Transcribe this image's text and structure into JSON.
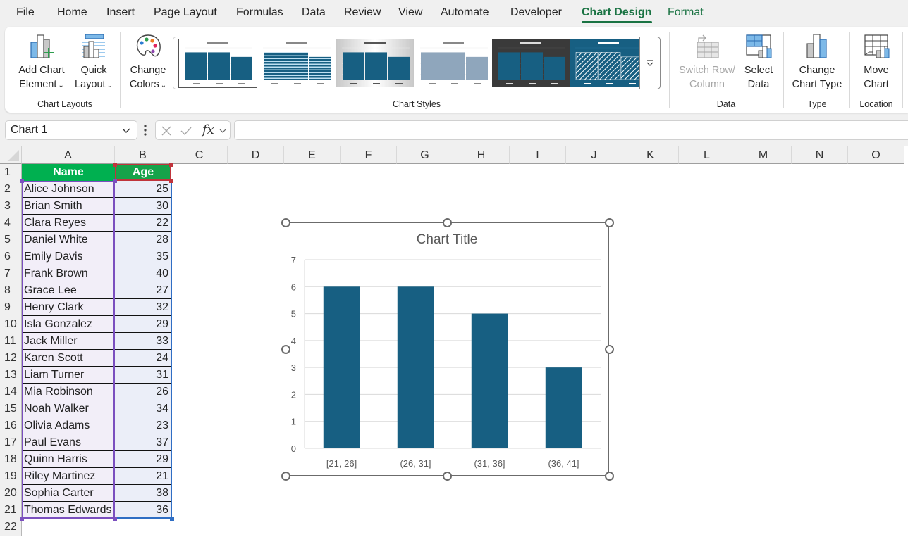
{
  "menu": {
    "tabs": [
      {
        "label": "File",
        "active": false
      },
      {
        "label": "Home",
        "active": false
      },
      {
        "label": "Insert",
        "active": false
      },
      {
        "label": "Page Layout",
        "active": false
      },
      {
        "label": "Formulas",
        "active": false
      },
      {
        "label": "Data",
        "active": false
      },
      {
        "label": "Review",
        "active": false
      },
      {
        "label": "View",
        "active": false
      },
      {
        "label": "Automate",
        "active": false
      },
      {
        "label": "Developer",
        "active": false
      },
      {
        "label": "Chart Design",
        "active": true
      },
      {
        "label": "Format",
        "active": false
      }
    ]
  },
  "ribbon": {
    "chart_layouts": {
      "group_label": "Chart Layouts",
      "add_chart_element": {
        "line1": "Add Chart",
        "line2": "Element"
      },
      "quick_layout": {
        "line1": "Quick",
        "line2": "Layout"
      }
    },
    "chart_styles": {
      "group_label": "Chart Styles",
      "change_colors": {
        "line1": "Change",
        "line2": "Colors"
      },
      "styles": [
        "Style 1",
        "Style 2",
        "Style 3",
        "Style 4",
        "Style 5",
        "Style 6"
      ],
      "selected_index": 0
    },
    "data": {
      "group_label": "Data",
      "switch_row_column": {
        "line1": "Switch Row/",
        "line2": "Column",
        "disabled": true
      },
      "select_data": {
        "line1": "Select",
        "line2": "Data"
      }
    },
    "type": {
      "group_label": "Type",
      "change_chart_type": {
        "line1": "Change",
        "line2": "Chart Type"
      }
    },
    "location": {
      "group_label": "Location",
      "move_chart": {
        "line1": "Move",
        "line2": "Chart"
      }
    }
  },
  "formula_bar": {
    "name_box": "Chart 1",
    "formula": "",
    "fx_label": "fx"
  },
  "sheet": {
    "columns": [
      "A",
      "B",
      "C",
      "D",
      "E",
      "F",
      "G",
      "H",
      "I",
      "J",
      "K",
      "L",
      "M",
      "N",
      "O"
    ],
    "rows": [
      "1",
      "2",
      "3",
      "4",
      "5",
      "6",
      "7",
      "8",
      "9",
      "10",
      "11",
      "12",
      "13",
      "14",
      "15",
      "16",
      "17",
      "18",
      "19",
      "20",
      "21",
      "22"
    ],
    "header": {
      "name": "Name",
      "age": "Age"
    },
    "data": [
      {
        "name": "Alice Johnson",
        "age": "25"
      },
      {
        "name": "Brian Smith",
        "age": "30"
      },
      {
        "name": "Clara Reyes",
        "age": "22"
      },
      {
        "name": "Daniel White",
        "age": "28"
      },
      {
        "name": "Emily Davis",
        "age": "35"
      },
      {
        "name": "Frank Brown",
        "age": "40"
      },
      {
        "name": "Grace Lee",
        "age": "27"
      },
      {
        "name": "Henry Clark",
        "age": "32"
      },
      {
        "name": "Isla Gonzalez",
        "age": "29"
      },
      {
        "name": "Jack Miller",
        "age": "33"
      },
      {
        "name": "Karen Scott",
        "age": "24"
      },
      {
        "name": "Liam Turner",
        "age": "31"
      },
      {
        "name": "Mia Robinson",
        "age": "26"
      },
      {
        "name": "Noah Walker",
        "age": "34"
      },
      {
        "name": "Olivia Adams",
        "age": "23"
      },
      {
        "name": "Paul Evans",
        "age": "37"
      },
      {
        "name": "Quinn Harris",
        "age": "29"
      },
      {
        "name": "Riley Martinez",
        "age": "21"
      },
      {
        "name": "Sophia Carter",
        "age": "38"
      },
      {
        "name": "Thomas Edwards",
        "age": "36"
      }
    ]
  },
  "colors": {
    "accent": "#1a7343",
    "bar": "#175f82",
    "header_green": "#00b050"
  },
  "chart_data": {
    "type": "bar",
    "title": "Chart Title",
    "categories": [
      "[21, 26]",
      "(26, 31]",
      "(31, 36]",
      "(36, 41]"
    ],
    "values": [
      6,
      6,
      5,
      3
    ],
    "xlabel": "",
    "ylabel": "",
    "ylim": [
      0,
      7
    ],
    "yticks": [
      "0",
      "1",
      "2",
      "3",
      "4",
      "5",
      "6",
      "7"
    ],
    "grid": true,
    "legend": "none"
  }
}
